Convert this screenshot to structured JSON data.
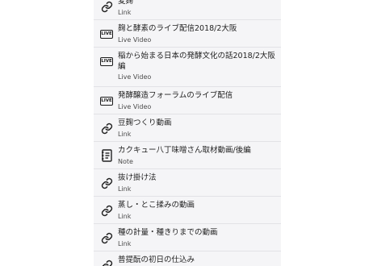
{
  "items": [
    {
      "title": "麦麹",
      "type": "Link",
      "icon": "link-icon"
    },
    {
      "title": "麹と酵素のライブ配信2018/2大阪",
      "type": "Live Video",
      "icon": "live-icon",
      "badge": "LIVE"
    },
    {
      "title": "稲から始まる日本の発酵文化の話2018/2大阪編",
      "type": "Live Video",
      "icon": "live-icon",
      "badge": "LIVE"
    },
    {
      "title": "発酵醸造フォーラムのライブ配信",
      "type": "Live Video",
      "icon": "live-icon",
      "badge": "LIVE"
    },
    {
      "title": "豆麹つくり動画",
      "type": "Link",
      "icon": "link-icon"
    },
    {
      "title": "カクキュー八丁味噌さん取材動画/後編",
      "type": "Note",
      "icon": "note-icon"
    },
    {
      "title": "抜け掛け法",
      "type": "Link",
      "icon": "link-icon"
    },
    {
      "title": "蒸し・とこ揉みの動画",
      "type": "Link",
      "icon": "link-icon"
    },
    {
      "title": "種の計量・種きりまでの動画",
      "type": "Link",
      "icon": "link-icon"
    },
    {
      "title": "普提酛の初日の仕込み",
      "type": "Link",
      "icon": "link-icon"
    }
  ]
}
